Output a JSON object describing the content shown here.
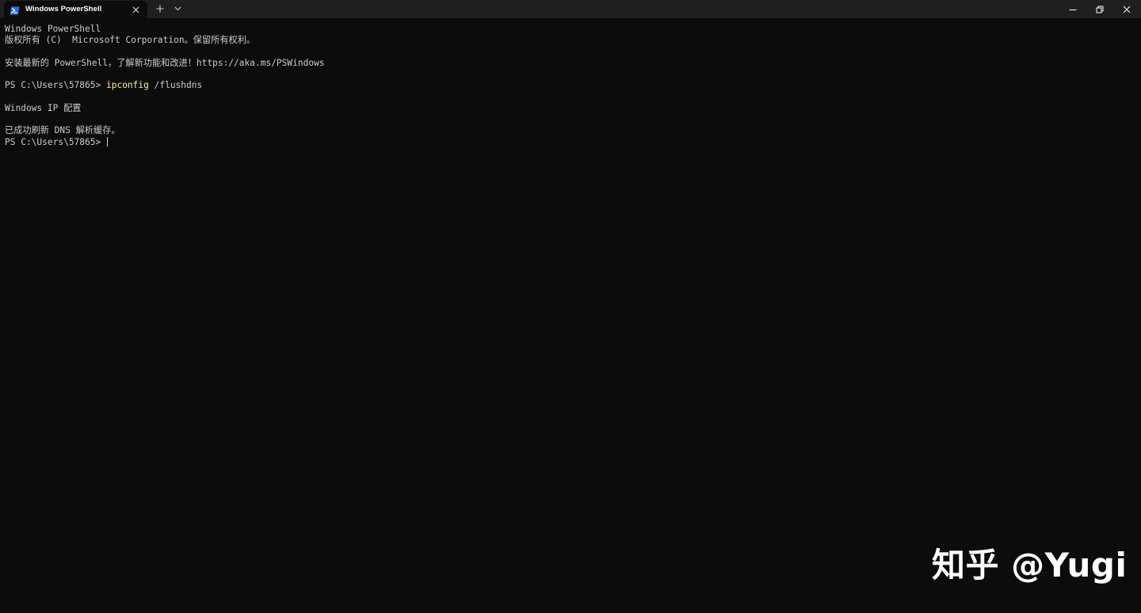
{
  "window": {
    "tab": {
      "title": "Windows PowerShell",
      "icon": "powershell-icon",
      "close_icon": "close-icon"
    },
    "tab_actions": {
      "new_tab_label": "+",
      "dropdown_icon": "chevron-down-icon"
    },
    "controls": {
      "minimize_icon": "minimize-icon",
      "restore_icon": "restore-icon",
      "close_icon": "close-icon"
    }
  },
  "terminal": {
    "lines": [
      "Windows PowerShell",
      "版权所有 (C)  Microsoft Corporation。保留所有权利。",
      "",
      "安装最新的 PowerShell，了解新功能和改进！https://aka.ms/PSWindows",
      "",
      "",
      "",
      "Windows IP 配置",
      "",
      "已成功刷新 DNS 解析缓存。",
      ""
    ],
    "command_prompt": "PS C:\\Users\\57865> ",
    "command_name": "ipconfig",
    "command_args": " /flushdns",
    "final_prompt": "PS C:\\Users\\57865> "
  },
  "colors": {
    "background": "#0c0c0c",
    "titlebar": "#1f1f1f",
    "text": "#cccccc",
    "command": "#f9f1a5"
  },
  "watermark": {
    "text": "知乎 @Yugi"
  }
}
